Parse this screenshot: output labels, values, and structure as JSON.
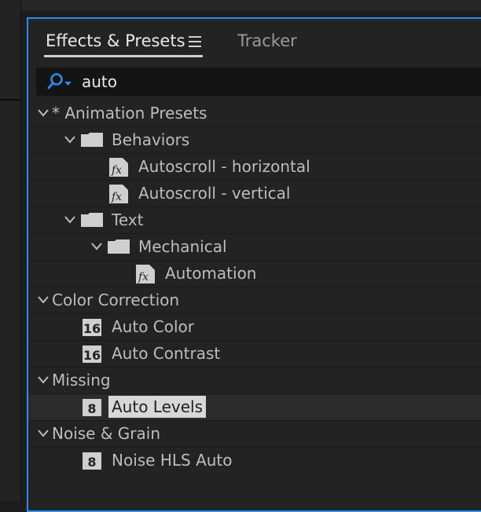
{
  "tabs": {
    "effects": "Effects & Presets",
    "tracker": "Tracker"
  },
  "search": {
    "value": "auto"
  },
  "tree": {
    "animation_presets": "* Animation Presets",
    "behaviors": "Behaviors",
    "autoscroll_horizontal": "Autoscroll - horizontal",
    "autoscroll_vertical": "Autoscroll - vertical",
    "text": "Text",
    "mechanical": "Mechanical",
    "automation": "Automation",
    "color_correction": "Color Correction",
    "auto_color": "Auto Color",
    "auto_contrast": "Auto Contrast",
    "missing": "Missing",
    "auto_levels": "Auto Levels",
    "noise_grain": "Noise & Grain",
    "noise_hls_auto": "Noise HLS Auto"
  },
  "badges": {
    "bit16": "16",
    "bit8": "8",
    "fx": "fx"
  },
  "icons": {
    "menu": "hamburger-menu-icon",
    "search": "search-icon",
    "folder": "folder-icon",
    "preset": "fx-preset-icon",
    "effect": "bit-depth-icon"
  },
  "colors": {
    "accent": "#2d8ceb",
    "panel_bg": "#232323",
    "selection_bg": "#d8d8d8"
  }
}
